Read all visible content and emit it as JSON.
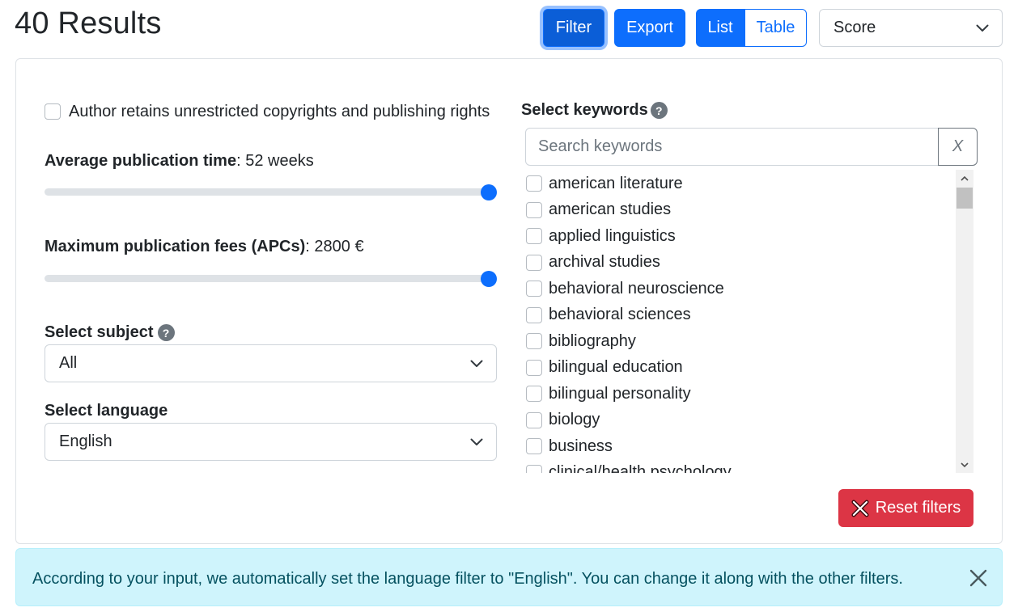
{
  "header": {
    "results_title": "40 Results",
    "filter_label": "Filter",
    "export_label": "Export",
    "view_list_label": "List",
    "view_table_label": "Table",
    "sort_value": "Score"
  },
  "filters": {
    "copyright_label": "Author retains unrestricted copyrights and publishing rights",
    "copyright_checked": false,
    "avg_time_label": "Average publication time",
    "avg_time_value": ": 52 weeks",
    "avg_time_slider_fraction": 1.0,
    "fees_label": "Maximum publication fees (APCs)",
    "fees_value": ": 2800 €",
    "fees_slider_fraction": 1.0,
    "subject_label": "Select subject",
    "subject_help": "?",
    "subject_value": "All",
    "language_label": "Select language",
    "language_value": "English",
    "keywords_label": "Select keywords",
    "keywords_help": "?",
    "keywords_placeholder": "Search keywords",
    "keywords_clear": "X",
    "keywords": [
      "american literature",
      "american studies",
      "applied linguistics",
      "archival studies",
      "behavioral neuroscience",
      "behavioral sciences",
      "bibliography",
      "bilingual education",
      "bilingual personality",
      "biology",
      "business",
      "clinical/health psychology"
    ],
    "reset_label": "Reset filters"
  },
  "alert": {
    "message": "According to your input, we automatically set the language filter to \"English\". You can change it along with the other filters."
  },
  "colors": {
    "primary": "#0d6efd",
    "danger": "#dc3545",
    "info_bg": "#cff4fc",
    "info_text": "#055160"
  }
}
